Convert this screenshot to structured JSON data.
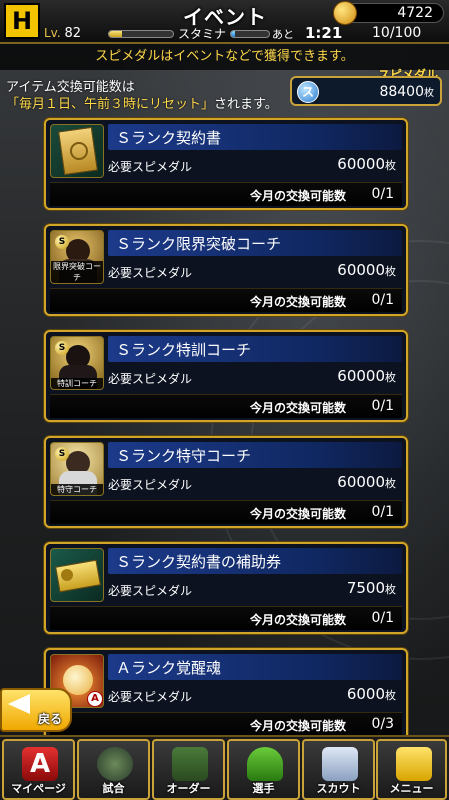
{
  "header": {
    "logo_text": "H",
    "title": "イベント",
    "level_label": "Lv.",
    "level_value": "82",
    "stamina_label": "スタミナ",
    "ato_label": "あと",
    "timer": "1:21",
    "stamina_value": "10/100",
    "coins": "4722"
  },
  "notice": "スピメダルはイベントなどで獲得できます。",
  "info": {
    "line1": "アイテム交換可能数は",
    "line2_highlight": "「毎月１日、午前３時にリセット」",
    "line2_rest": "されます。"
  },
  "medal": {
    "label": "スピメダル",
    "icon_text": "ス",
    "value": "88400",
    "unit": "枚"
  },
  "common": {
    "required_label": "必要スピメダル",
    "unit": "枚",
    "limit_label": "今月の交換可能数"
  },
  "items": [
    {
      "title": "Ｓランク契約書",
      "price": "60000",
      "limit": "0/1",
      "thumb_label": ""
    },
    {
      "title": "Ｓランク限界突破コーチ",
      "price": "60000",
      "limit": "0/1",
      "thumb_label": "限界突破コーチ"
    },
    {
      "title": "Ｓランク特訓コーチ",
      "price": "60000",
      "limit": "0/1",
      "thumb_label": "特訓コーチ"
    },
    {
      "title": "Ｓランク特守コーチ",
      "price": "60000",
      "limit": "0/1",
      "thumb_label": "特守コーチ"
    },
    {
      "title": "Ｓランク契約書の補助券",
      "price": "7500",
      "limit": "0/1",
      "thumb_label": ""
    },
    {
      "title": "Ａランク覚醒魂",
      "price": "6000",
      "limit": "0/3",
      "thumb_label": ""
    }
  ],
  "back_label": "戻る",
  "footer": [
    {
      "label": "マイページ",
      "icon": "mypage-icon"
    },
    {
      "label": "試合",
      "icon": "stadium-icon"
    },
    {
      "label": "オーダー",
      "icon": "order-icon"
    },
    {
      "label": "選手",
      "icon": "player-icon"
    },
    {
      "label": "スカウト",
      "icon": "scout-icon"
    },
    {
      "label": "メニュー",
      "icon": "menu-icon"
    }
  ],
  "colors": {
    "accent_gold": "#d1a628",
    "highlight_yellow": "#ffd84a",
    "title_blue": "#1c3a8a"
  },
  "progress": {
    "exp_fraction": 0.2,
    "stamina_fraction": 0.1
  }
}
